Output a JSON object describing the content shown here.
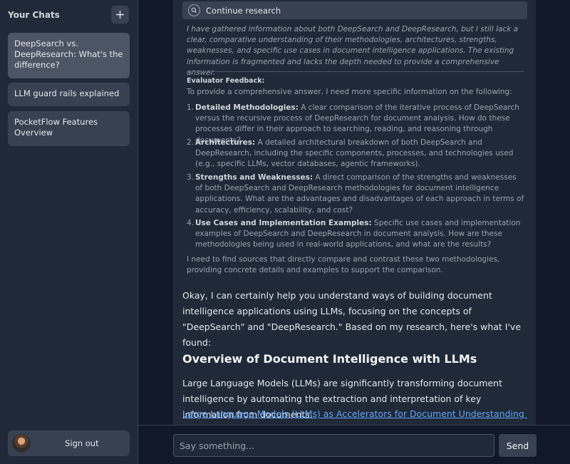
{
  "sidebar": {
    "title": "Your Chats",
    "new_chat_icon": "plus-icon",
    "chats": [
      {
        "label": "DeepSearch vs. DeepResearch: What's the difference?",
        "active": true
      },
      {
        "label": "LLM guard rails explained",
        "active": false
      },
      {
        "label": "PocketFlow Features Overview",
        "active": false
      }
    ],
    "sign_out_label": "Sign out"
  },
  "message": {
    "tool_label": "Continue research",
    "tool_icon": "search-icon",
    "thought": "I have gathered information about both DeepSearch and DeepResearch, but I still lack a clear, comparative understanding of their methodologies, architectures, strengths, weaknesses, and specific use cases in document intelligence applications. The existing information is fragmented and lacks the depth needed to provide a comprehensive answer.",
    "feedback_title": "Evaluator Feedback:",
    "feedback_intro": "To provide a comprehensive answer, I need more specific information on the following:",
    "feedback_items": [
      {
        "num": "1.",
        "title": "Detailed Methodologies:",
        "text": " A clear comparison of the iterative process of DeepSearch versus the recursive process of DeepResearch for document analysis. How do these processes differ in their approach to searching, reading, and reasoning through documents?"
      },
      {
        "num": "2.",
        "title": "Architectures:",
        "text": " A detailed architectural breakdown of both DeepSearch and DeepResearch, including the specific components, processes, and technologies used (e.g., specific LLMs, vector databases, agentic frameworks)."
      },
      {
        "num": "3.",
        "title": "Strengths and Weaknesses:",
        "text": " A direct comparison of the strengths and weaknesses of both DeepSearch and DeepResearch methodologies for document intelligence applications. What are the advantages and disadvantages of each approach in terms of accuracy, efficiency, scalability, and cost?"
      },
      {
        "num": "4.",
        "title": "Use Cases and Implementation Examples:",
        "text": " Specific use cases and implementation examples of DeepSearch and DeepResearch in document analysis. How are these methodologies being used in real-world applications, and what are the results?"
      }
    ],
    "feedback_closing": "I need to find sources that directly compare and contrast these two methodologies, providing concrete details and examples to support the comparison.",
    "answer_intro": "Okay, I can certainly help you understand ways of building document intelligence applications using LLMs, focusing on the concepts of \"DeepSearch\" and \"DeepResearch.\" Based on my research, here's what I've found:",
    "answer_heading": "Overview of Document Intelligence with LLMs",
    "answer_paragraph": "Large Language Models (LLMs) are significantly transforming document intelligence by automating the extraction and interpretation of key information from documents.",
    "answer_link": "Large Language Models (LLMs) as Accelerators for Document Understanding in"
  },
  "composer": {
    "placeholder": "Say something...",
    "send_label": "Send"
  }
}
